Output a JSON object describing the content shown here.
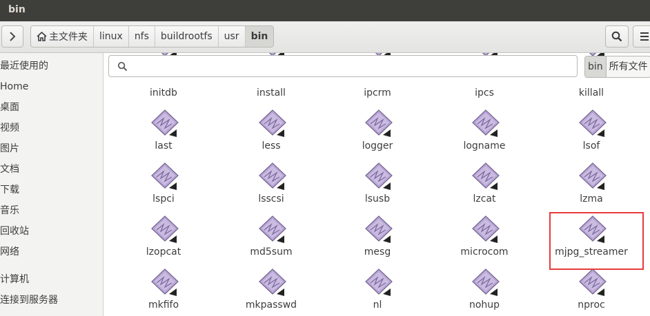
{
  "window": {
    "title": "bin"
  },
  "toolbar": {
    "forward_icon": "chevron-right-icon",
    "home_icon": "home-icon",
    "breadcrumbs": [
      "主文件夹",
      "linux",
      "nfs",
      "buildrootfs",
      "usr",
      "bin"
    ],
    "search_icon": "search-icon",
    "menu_icon": "hamburger-menu-icon"
  },
  "sidebar": {
    "items": [
      "最近使用的",
      "Home",
      "桌面",
      "视频",
      "图片",
      "文档",
      "下载",
      "音乐",
      "回收站",
      "网络",
      "计算机",
      "连接到服务器"
    ]
  },
  "search": {
    "value": "",
    "placeholder": ""
  },
  "scope": {
    "options": [
      "bin",
      "所有文件"
    ],
    "selected": "bin"
  },
  "files": [
    "initdb",
    "install",
    "ipcrm",
    "ipcs",
    "killall",
    "last",
    "less",
    "logger",
    "logname",
    "lsof",
    "lspci",
    "lsscsi",
    "lsusb",
    "lzcat",
    "lzma",
    "lzopcat",
    "md5sum",
    "mesg",
    "microcom",
    "mjpg_streamer",
    "mkfifo",
    "mkpasswd",
    "nl",
    "nohup",
    "nproc"
  ],
  "file_icon": "executable-file-icon",
  "highlighted_file": "mjpg_streamer",
  "colors": {
    "highlight_border": "#e63a3a",
    "icon_fill": "#b8a5d6",
    "titlebar": "#3e3e3b"
  }
}
